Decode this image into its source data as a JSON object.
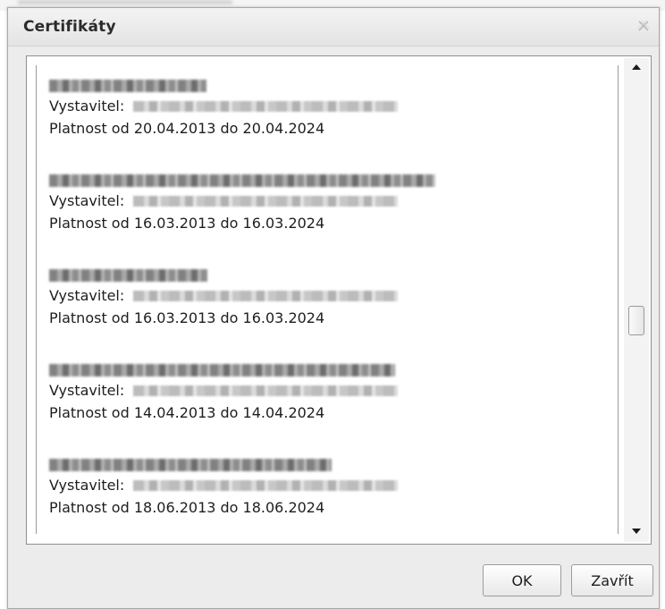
{
  "dialog": {
    "title": "Certifikáty",
    "close_icon": "close-icon"
  },
  "certificates": [
    {
      "issuer_label": "Vystavitel:",
      "validity": "Platnost od 20.04.2013 do 20.04.2024"
    },
    {
      "issuer_label": "Vystavitel:",
      "validity": "Platnost od 16.03.2013 do 16.03.2024"
    },
    {
      "issuer_label": "Vystavitel:",
      "validity": "Platnost od 16.03.2013 do 16.03.2024"
    },
    {
      "issuer_label": "Vystavitel:",
      "validity": "Platnost od 14.04.2013 do 14.04.2024"
    },
    {
      "issuer_label": "Vystavitel:",
      "validity": "Platnost od 18.06.2013 do 18.06.2024"
    }
  ],
  "scrollbar": {
    "up_icon": "arrow-up-icon",
    "down_icon": "arrow-down-icon",
    "position": 0.55
  },
  "buttons": {
    "ok_label": "OK",
    "close_label": "Zavřít"
  },
  "colors": {
    "dialog_bg": "#ececec",
    "border": "#8e8e8e",
    "text": "#1e1e1e"
  }
}
